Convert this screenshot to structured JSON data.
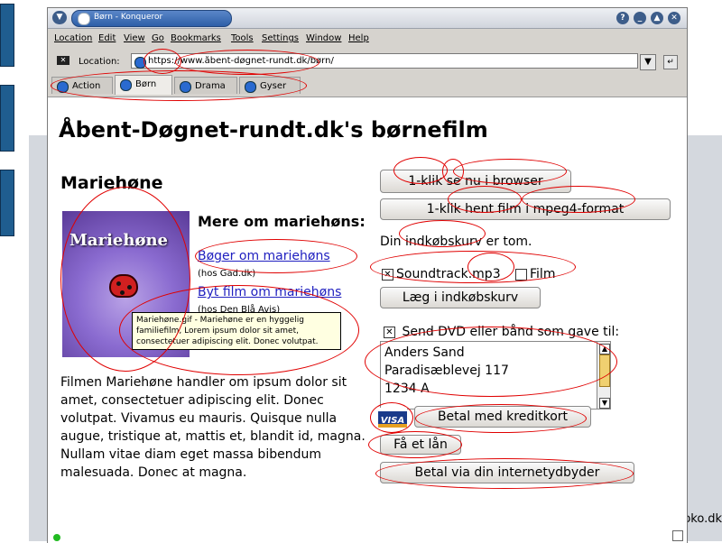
{
  "window": {
    "title": "Børn - Konqueror",
    "buttons": {
      "help": "?",
      "minimize": "_",
      "maximize": "▲",
      "close": "✕"
    }
  },
  "menubar": [
    "Location",
    "Edit",
    "View",
    "Go",
    "Bookmarks",
    "Tools",
    "Settings",
    "Window",
    "Help"
  ],
  "location": {
    "label": "Location:",
    "url": "https://www.åbent-døgnet-rundt.dk/børn/"
  },
  "tabs": [
    {
      "label": "Action",
      "active": false
    },
    {
      "label": "Børn",
      "active": true
    },
    {
      "label": "Drama",
      "active": false
    },
    {
      "label": "Gyser",
      "active": false
    }
  ],
  "page": {
    "title": "Åbent-Døgnet-rundt.dk's børnefilm",
    "movie_title": "Mariehøne",
    "poster_text": "Mariehøne",
    "more_heading": "Mere om mariehøns:",
    "link_books": "Bøger om mariehøns",
    "link_books_source": "(hos Gad.dk)",
    "link_swap": "Byt film om mariehøns",
    "link_swap_source": "(hos Den Blå Avis)",
    "tooltip": "Mariehøne.gif - Mariehøne er en hyggelig familiefilm, Lorem ipsum dolor sit amet, consectetuer adipiscing elit. Donec volutpat.",
    "description": "Filmen Mariehøne handler om ipsum dolor sit amet, consectetuer adipiscing elit. Donec volutpat. Vivamus eu mauris. Quisque nulla augue, tristique at, mattis et, blandit id, magna. Nullam vitae diam eget massa bibendum malesuada. Donec at magna."
  },
  "actions": {
    "watch_button": "1-klik se nu i browser",
    "download_button": "1-klik hent film i mpeg4-format",
    "cart_status": "Din indkøbskurv er tom.",
    "option_soundtrack": "Soundtrack.mp3",
    "option_soundtrack_checked": true,
    "option_film": "Film",
    "option_film_checked": false,
    "add_to_cart": "Læg i indkøbskurv",
    "gift_label": "Send DVD eller bånd som gave til:",
    "gift_checked": true,
    "address_lines": [
      "Anders Sand",
      "Paradisæblevej 117",
      "1234 A"
    ],
    "visa_logo": "VISA",
    "pay_card": "Betal med kreditkort",
    "get_loan": "Få et lån",
    "pay_isp": "Betal via din internetydbyder"
  },
  "slide_footer": "oko.dk"
}
